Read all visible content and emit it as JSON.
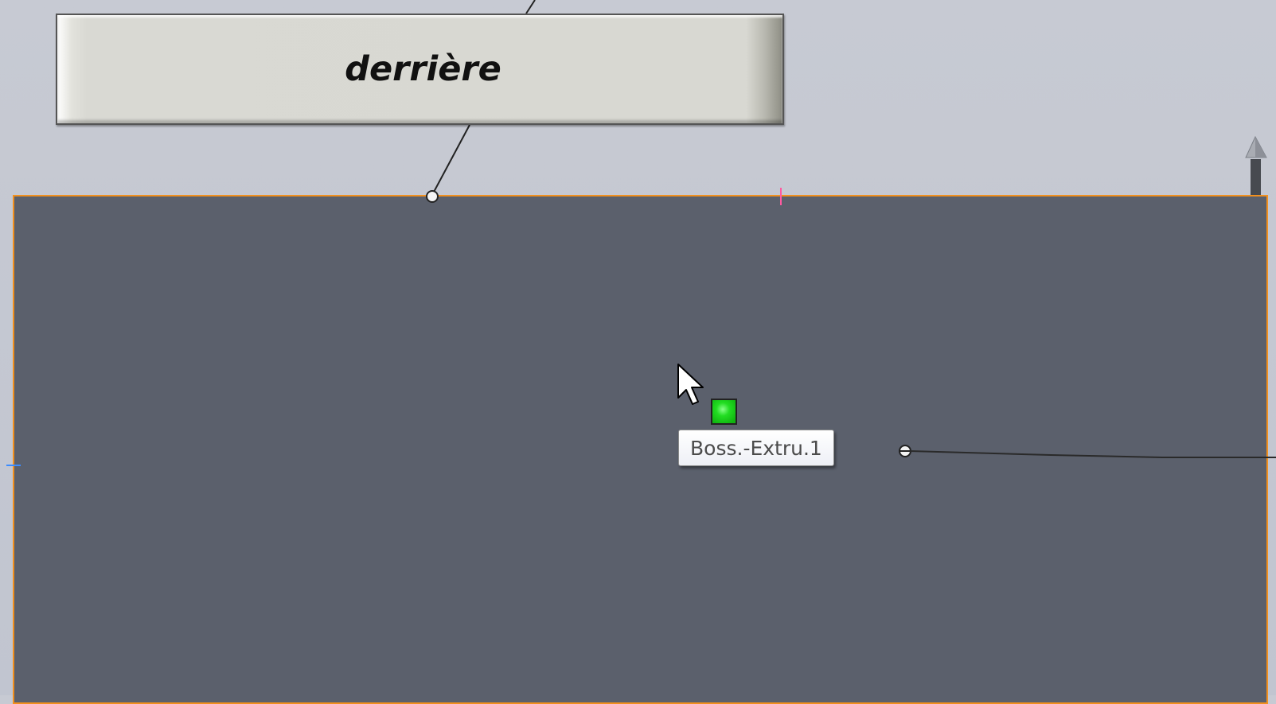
{
  "view_label": {
    "text": "derrière"
  },
  "feature_tooltip": {
    "text": "Boss.-Extru.1"
  },
  "colors": {
    "background": "#c4c8d2",
    "face": "#5b606c",
    "selection_edge": "#f2901e",
    "feature_glyph": "#22dd22",
    "midpoint_marker": "#ff5aa0",
    "origin_marker": "#3b8cff"
  },
  "icons": {
    "cursor": "arrow-cursor-icon",
    "feature": "green-square-feature-icon",
    "direction": "arrow-up-icon"
  }
}
